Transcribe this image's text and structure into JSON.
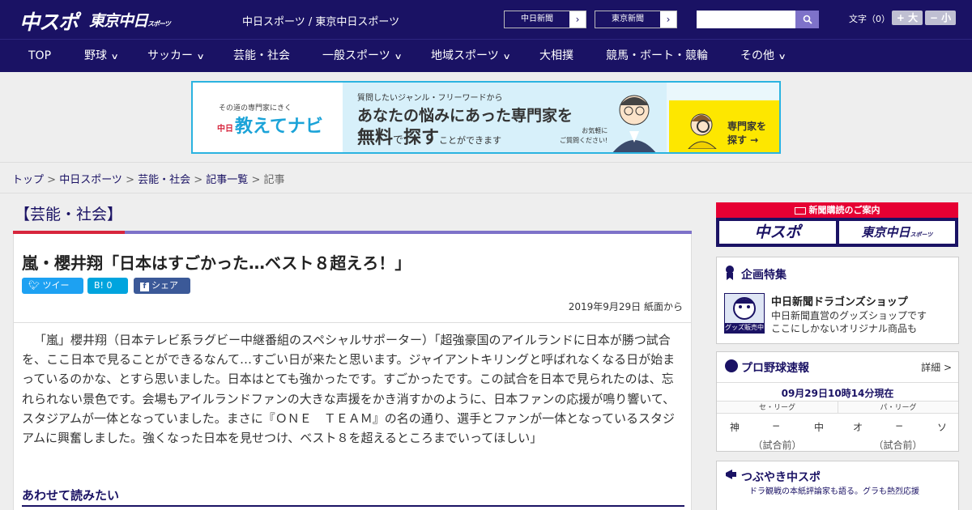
{
  "header": {
    "logo_chuspo": "中スポ",
    "logo_tokyo": "東京中日",
    "logo_tokyo_small": "スポーツ",
    "site_title": "中日スポーツ / 東京中日スポーツ",
    "paper_links": [
      "中日新聞",
      "東京新聞"
    ],
    "search_placeholder": "",
    "font_size_label": "文字（0）",
    "font_plus": "+ 大",
    "font_minus": "− 小"
  },
  "nav": {
    "items": [
      "TOP",
      "野球",
      "サッカー",
      "芸能・社会",
      "一般スポーツ",
      "地域スポーツ",
      "大相撲",
      "競馬・ボート・競輪",
      "その他"
    ]
  },
  "ad": {
    "small": "その道の専門家にきく",
    "brand_chu": "中日",
    "brand": "教えてナビ",
    "line1": "質問したいジャンル・フリーワードから",
    "line2": "あなたの悩みにあった専門家を",
    "line3a": "無料",
    "line3b": "で",
    "line3c": "探す",
    "line3d": "ことができます",
    "line4a": "お気軽に",
    "line4b": "ご質問ください!",
    "cta1": "専門家を",
    "cta2": "探す →"
  },
  "breadcrumb": {
    "items": [
      "トップ",
      "中日スポーツ",
      "芸能・社会",
      "記事一覧"
    ],
    "current": "記事",
    "sep": " > "
  },
  "article": {
    "category": "【芸能・社会】",
    "title": "嵐・櫻井翔「日本はすごかった…ベスト８超えろ！」",
    "share_twitter": "ツイート",
    "share_hatena": "B! 0",
    "share_facebook": "シェア 0",
    "date": "2019年9月29日 紙面から",
    "body": "「嵐」櫻井翔（日本テレビ系ラグビー中継番組のスペシャルサポーター）「超強豪国のアイルランドに日本が勝つ試合を、ここ日本で見ることができるなんて…すごい日が来たと思います。ジャイアントキリングと呼ばれなくなる日が始まっているのかな、とすら思いました。日本はとても強かったです。すごかったです。この試合を日本で見られたのは、忘れられない景色です。会場もアイルランドファンの大きな声援をかき消すかのように、日本ファンの応援が鳴り響いて、スタジアムが一体となっていました。まさに『ＯＮＥ　ＴＥＡＭ』の名の通り、選手とファンが一体となっているスタジアムに興奮しました。強くなった日本を見せつけ、ベスト８を超えるところまでいってほしい」",
    "related_heading": "あわせて読みたい"
  },
  "sidebar": {
    "subscribe_head": "新聞購読のご案内",
    "subscribe_logos": [
      "中スポ",
      "東京中日"
    ],
    "subscribe_logo_small": "スポーツ",
    "feature_title": "企画特集",
    "shop_name": "中日新聞ドラゴンズショップ",
    "shop_desc1": "中日新聞直営のグッズショップです",
    "shop_desc2": "ここにしかないオリジナル商品も",
    "shop_img_label": "グッズ販売中",
    "baseball_title": "プロ野球速報",
    "baseball_more": "詳細 >",
    "baseball_time": "09月29日10時14分現在",
    "league_central": "セ・リーグ",
    "league_pacific": "パ・リーグ",
    "central_home": "神",
    "central_vs": "−",
    "central_away": "中",
    "pacific_home": "オ",
    "pacific_vs": "−",
    "pacific_away": "ソ",
    "pre_game": "（試合前）",
    "tweet_title": "つぶやき中スポ",
    "tweet_sub": "ドラ観戦の本紙評論家も語る。グラも熱烈応援"
  },
  "colors": {
    "brand_navy": "#1a1264",
    "accent_red": "#e60033",
    "accent_purple": "#7e72c9"
  }
}
